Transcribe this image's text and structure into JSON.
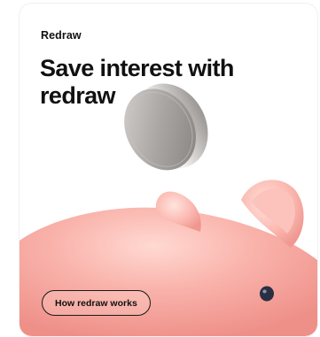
{
  "card": {
    "eyebrow": "Redraw",
    "headline": "Save interest with redraw",
    "cta_label": "How redraw works"
  },
  "illustration": {
    "icons": [
      "coin-icon",
      "piggy-bank-icon"
    ],
    "colors": {
      "pig_body": "#f7a9a3",
      "pig_highlight": "#ffd3cc",
      "coin": "#b9b6b3"
    }
  }
}
